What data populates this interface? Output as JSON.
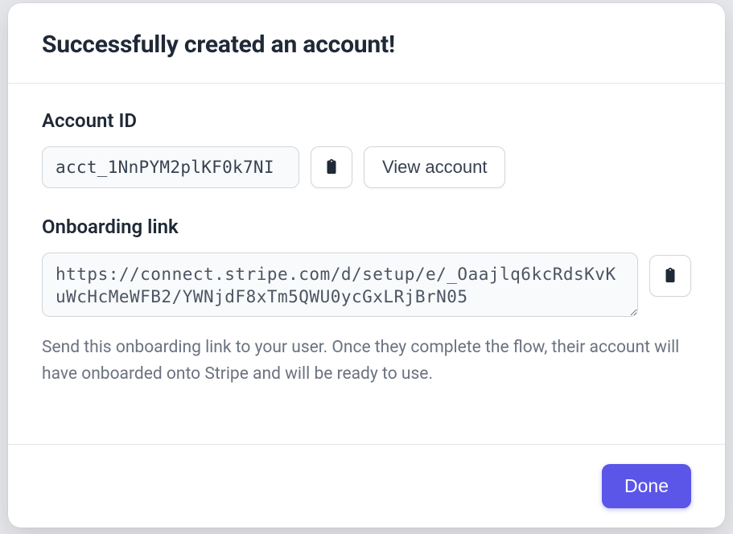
{
  "modal": {
    "title": "Successfully created an account!",
    "account_id": {
      "label": "Account ID",
      "value": "acct_1NnPYM2plKF0k7NI",
      "view_button": "View account"
    },
    "onboarding": {
      "label": "Onboarding link",
      "value": "https://connect.stripe.com/d/setup/e/_Oaajlq6kcRdsKvKuWcHcMeWFB2/YWNjdF8xTm5QWU0ycGxLRjBrN05",
      "helper": "Send this onboarding link to your user. Once they complete the flow, their account will have onboarded onto Stripe and will be ready to use."
    },
    "footer": {
      "done": "Done"
    }
  }
}
